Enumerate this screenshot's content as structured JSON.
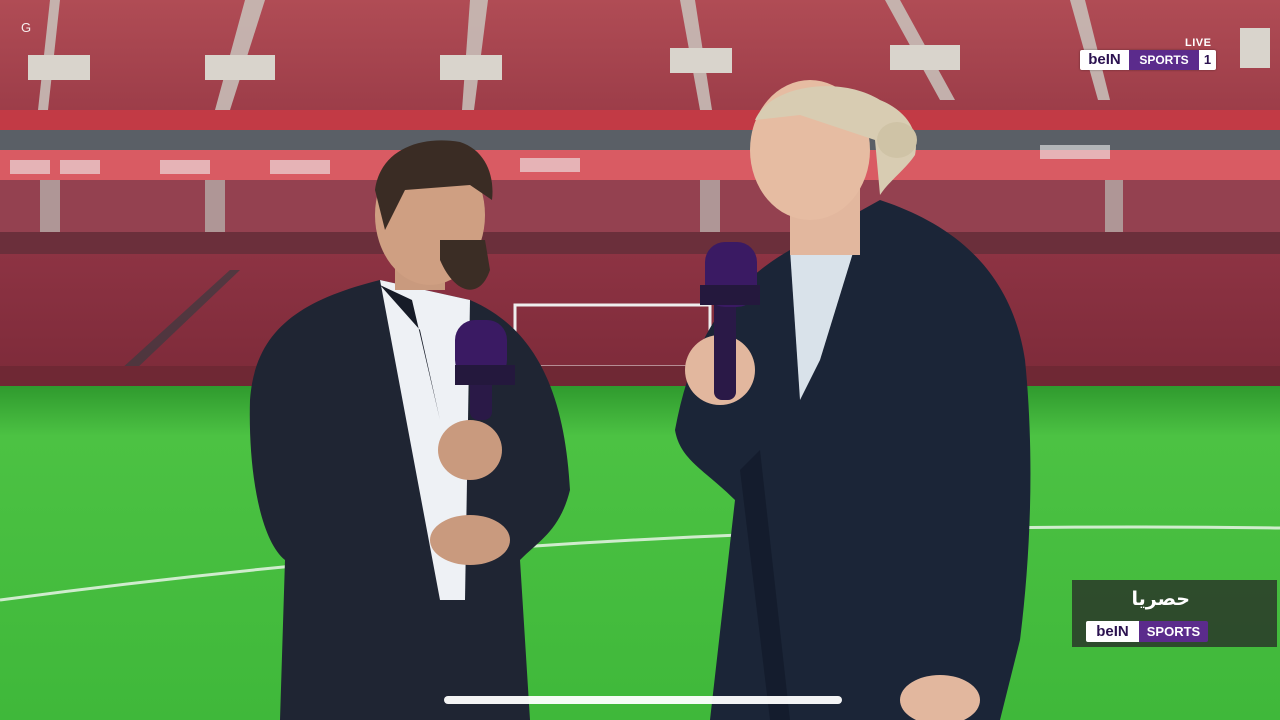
{
  "overlay": {
    "corner_letter": "G",
    "live_label": "LIVE",
    "channel_logo": {
      "brand": "beIN",
      "product": "SPORTS",
      "number": "1"
    },
    "exclusive_label": "حصريا",
    "bottom_logo": {
      "brand": "beIN",
      "product": "SPORTS"
    }
  },
  "scene": {
    "description_icon": "stadium-interview-video-frame",
    "colors": {
      "pitch": "#3fb83a",
      "seats": "#8a2e3c",
      "suit": "#1e2636",
      "mic": "#3a1a63"
    }
  },
  "player": {
    "home_indicator": "home-indicator"
  }
}
